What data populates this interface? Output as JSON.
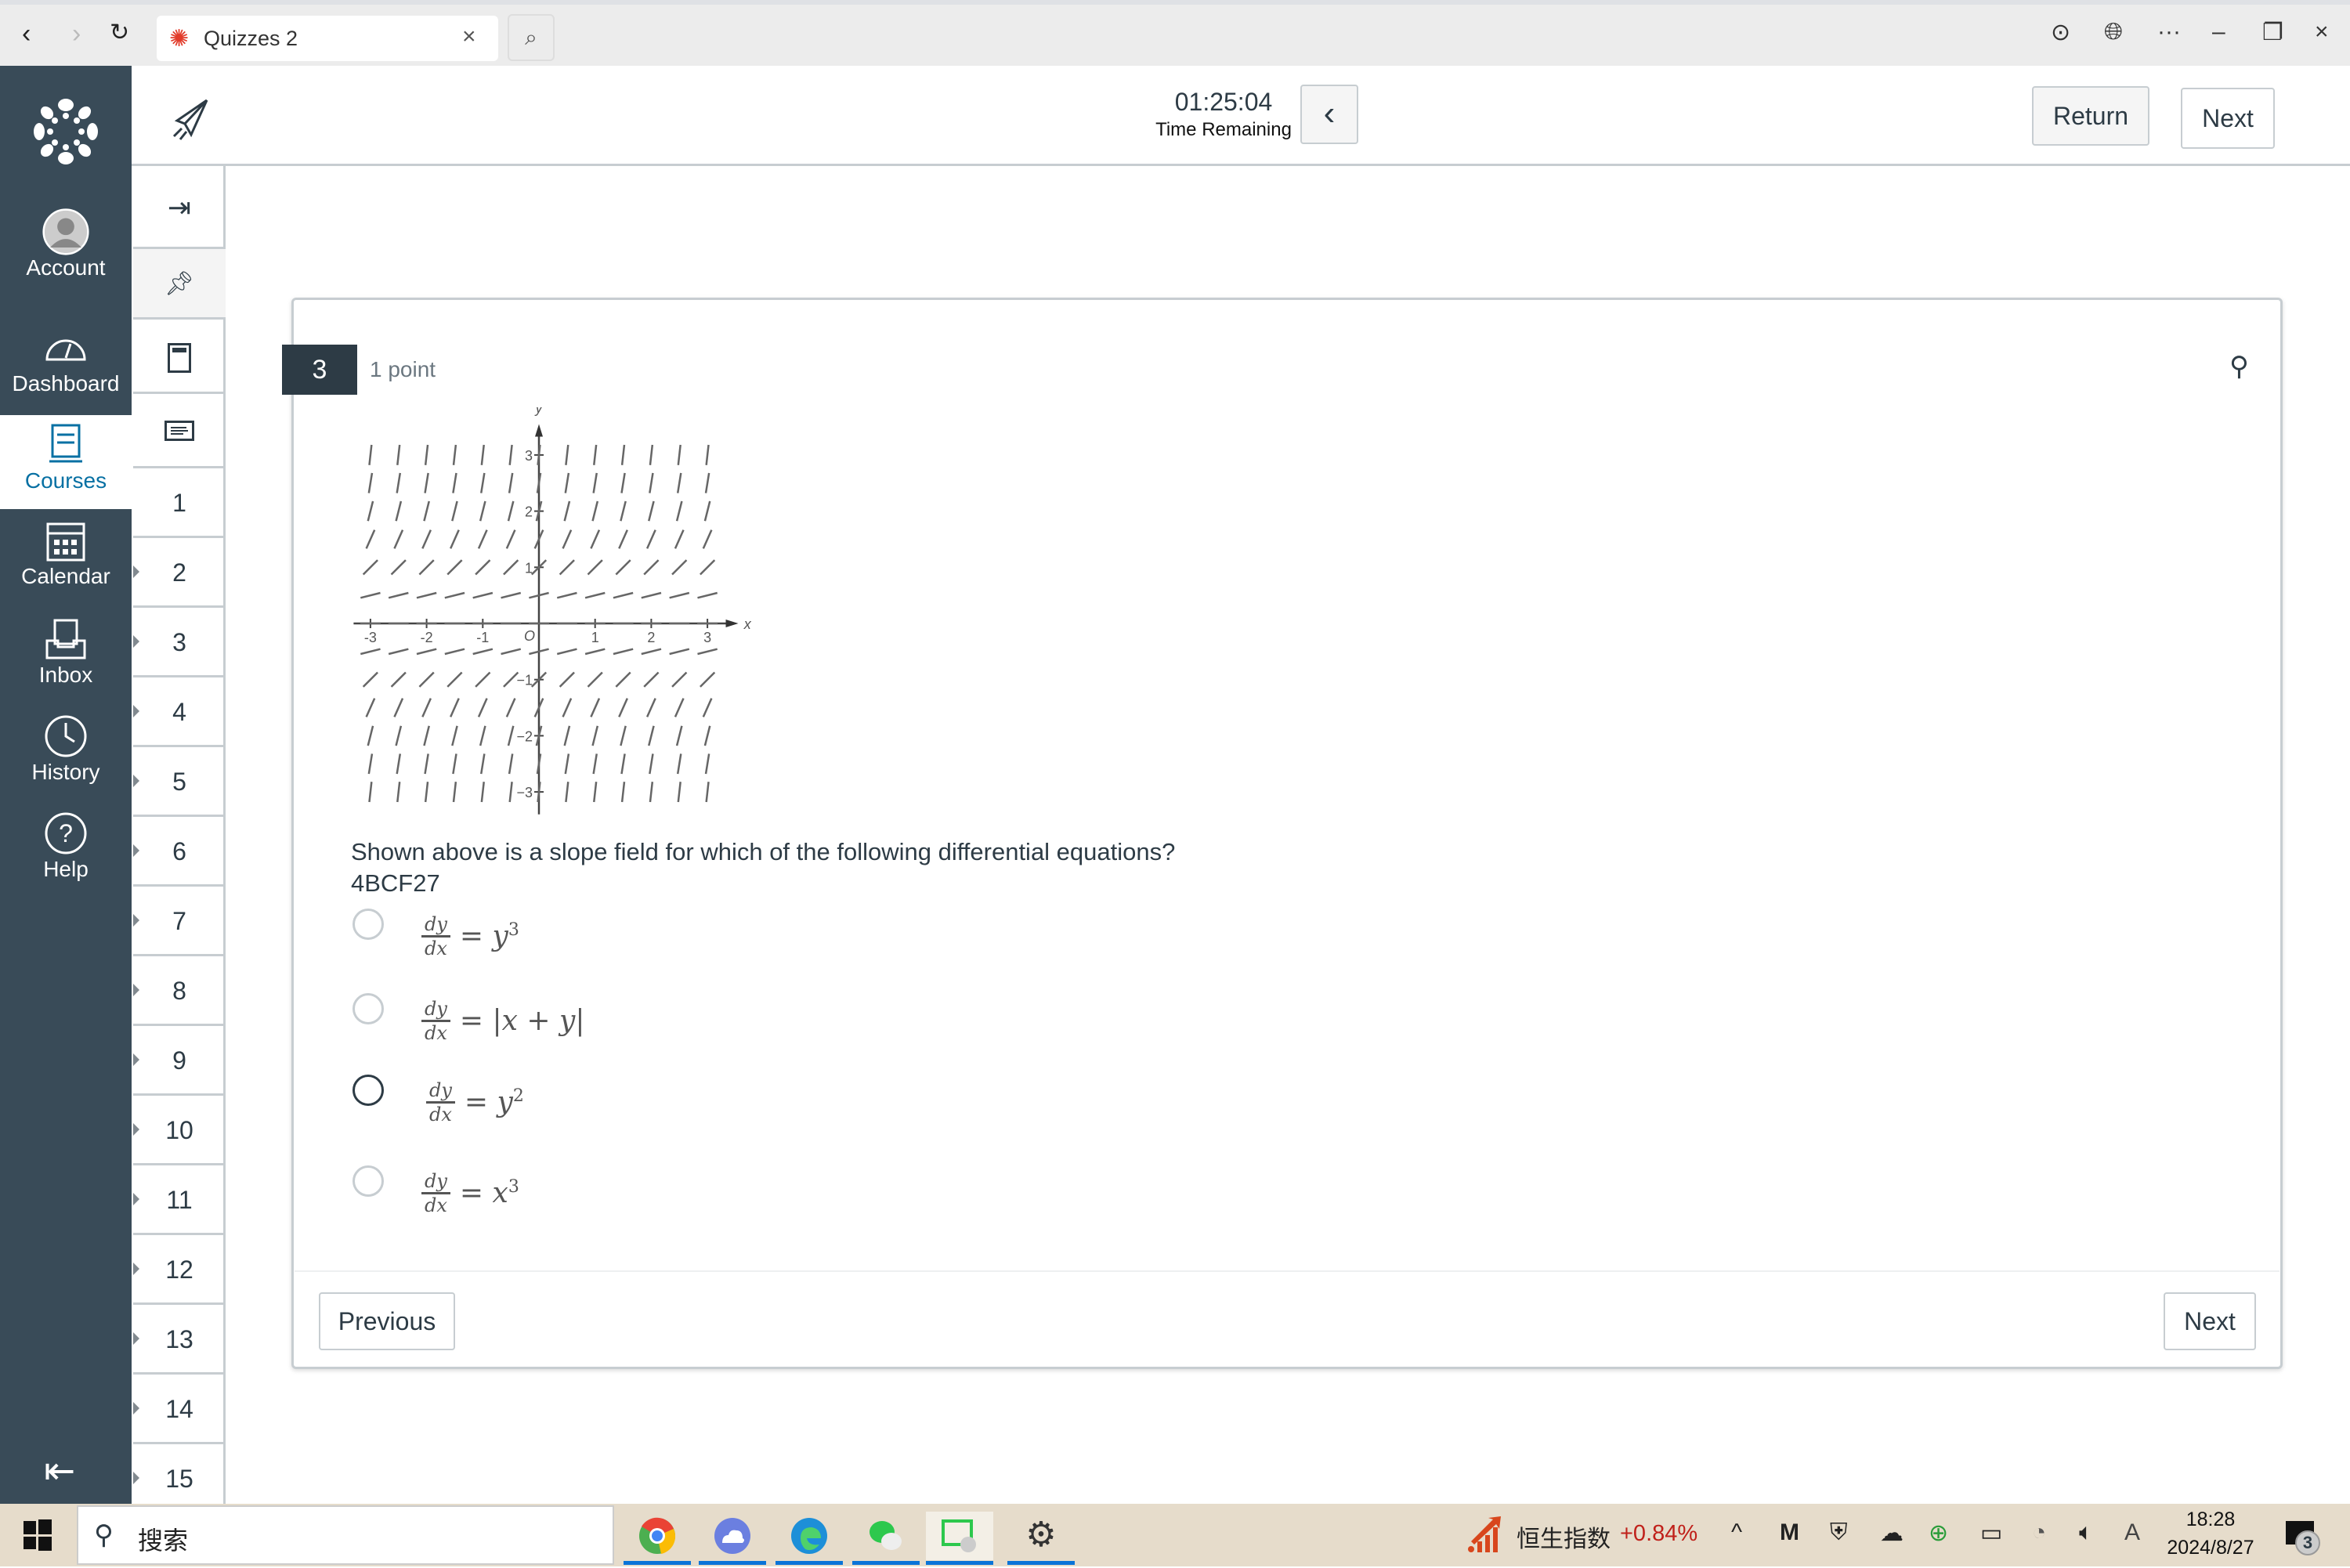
{
  "browser": {
    "tab_title": "Quizzes 2",
    "tab_close": "×",
    "search_icon": "search-icon",
    "controls": {
      "minimize": "–",
      "restore": "❐",
      "close": "×",
      "more": "···"
    }
  },
  "sidebar": {
    "items": [
      {
        "label": "Account",
        "icon": "avatar-icon"
      },
      {
        "label": "Dashboard",
        "icon": "dashboard-icon"
      },
      {
        "label": "Courses",
        "icon": "courses-icon",
        "active": true
      },
      {
        "label": "Calendar",
        "icon": "calendar-icon"
      },
      {
        "label": "Inbox",
        "icon": "inbox-icon"
      },
      {
        "label": "History",
        "icon": "history-icon"
      },
      {
        "label": "Help",
        "icon": "help-icon"
      }
    ]
  },
  "header": {
    "timer": "01:25:04",
    "timer_label": "Time Remaining",
    "return_label": "Return",
    "next_label": "Next"
  },
  "qnav": {
    "numbers": [
      "1",
      "2",
      "3",
      "4",
      "5",
      "6",
      "7",
      "8",
      "9",
      "10",
      "11",
      "12",
      "13",
      "14",
      "15"
    ]
  },
  "question": {
    "number": "3",
    "points": "1 point",
    "text": "Shown above is a slope field for which of the following differential equations?",
    "code": "4BCF27",
    "options": [
      {
        "lhs_num": "dy",
        "lhs_den": "dx",
        "rhs": "y",
        "exp": "3"
      },
      {
        "lhs_num": "dy",
        "lhs_den": "dx",
        "rhs": "|x + y|",
        "exp": ""
      },
      {
        "lhs_num": "dy",
        "lhs_den": "dx",
        "rhs": "y",
        "exp": "2"
      },
      {
        "lhs_num": "dy",
        "lhs_den": "dx",
        "rhs": "x",
        "exp": "3"
      }
    ],
    "previous_label": "Previous",
    "next_label": "Next"
  },
  "chart_data": {
    "type": "slope-field",
    "xlabel": "x",
    "ylabel": "y",
    "origin_label": "O",
    "xlim": [
      -3,
      3
    ],
    "ylim": [
      -3,
      3
    ],
    "x_ticks": [
      "-3",
      "-2",
      "-1",
      "1",
      "2",
      "3"
    ],
    "y_ticks": [
      "3",
      "2",
      "1",
      "−1",
      "−2",
      "−3"
    ],
    "x_values": [
      -3,
      -2.5,
      -2,
      -1.5,
      -1,
      -0.5,
      0,
      0.5,
      1,
      1.5,
      2,
      2.5,
      3
    ],
    "y_values": [
      3,
      2.5,
      2,
      1.5,
      1,
      0.5,
      0,
      -0.5,
      -1,
      -1.5,
      -2,
      -2.5,
      -3
    ],
    "slopes_by_row": [
      9,
      6.25,
      4,
      2.25,
      1,
      0.25,
      0,
      0.25,
      1,
      2.25,
      4,
      6.25,
      9
    ]
  },
  "taskbar": {
    "search_placeholder": "搜索",
    "stock_name": "恒生指数",
    "stock_change": "+0.84%",
    "stock_color": "#c0201a",
    "time": "18:28",
    "date": "2024/8/27",
    "notifications": "3"
  }
}
